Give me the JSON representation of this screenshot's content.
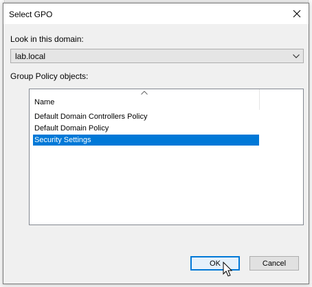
{
  "dialog": {
    "title": "Select GPO",
    "close_icon": "close-icon"
  },
  "domain": {
    "label": "Look in this domain:",
    "selected": "lab.local",
    "dropdown_icon": "chevron-down-icon"
  },
  "gpo_list": {
    "label": "Group Policy objects:",
    "column_header": "Name",
    "sort_icon": "sort-ascending-icon",
    "items": [
      {
        "name": "Default Domain Controllers Policy",
        "selected": false
      },
      {
        "name": "Default Domain Policy",
        "selected": false
      },
      {
        "name": "Security Settings",
        "selected": true
      }
    ]
  },
  "buttons": {
    "ok_label": "OK",
    "cancel_label": "Cancel"
  },
  "colors": {
    "selection": "#0078d7",
    "selection_text": "#ffffff",
    "titlebar": "#ffffff",
    "dialog_bg": "#f0f0f0"
  },
  "pointer": "arrow-cursor-icon"
}
